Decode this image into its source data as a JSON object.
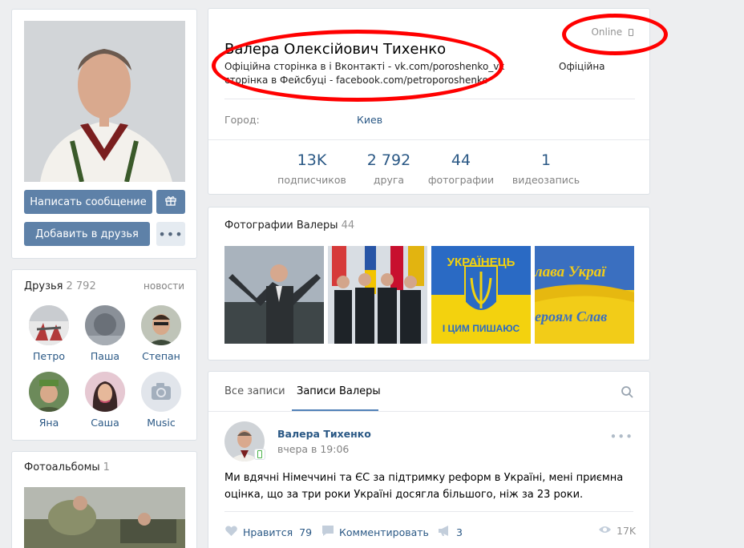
{
  "profile": {
    "name": "Валера Олексійович Тихенко",
    "line1": "Офіційна сторінка в і Вконтакті - vk.com/poroshenko_vk",
    "line2": "сторінка в Фейсбуці - facebook.com/petroporoshenko",
    "online": "Online",
    "official": "Офіційна",
    "city_label": "Город:",
    "city_value": "Киев",
    "stats": [
      {
        "value": "13K",
        "label": "подписчиков"
      },
      {
        "value": "2 792",
        "label": "друга"
      },
      {
        "value": "44",
        "label": "фотографии"
      },
      {
        "value": "1",
        "label": "видеозапись"
      }
    ]
  },
  "actions": {
    "message": "Написать сообщение",
    "add_friend": "Добавить в друзья"
  },
  "friends": {
    "title": "Друзья",
    "count": "2 792",
    "news": "новости",
    "items": [
      {
        "name": "Петро"
      },
      {
        "name": "Паша"
      },
      {
        "name": "Степан"
      },
      {
        "name": "Яна"
      },
      {
        "name": "Саша"
      },
      {
        "name": "Music"
      }
    ]
  },
  "albums": {
    "title": "Фотоальбомы",
    "count": "1"
  },
  "photos": {
    "title": "Фотографии Валеры",
    "count": "44",
    "pic3_top": "УКРАЇНЕЦЬ",
    "pic3_bottom": "І ЦИМ ПИШАЮС",
    "pic4_top": "лава Украї",
    "pic4_bottom": "ероям Слав"
  },
  "wall": {
    "tabs": [
      "Все записи",
      "Записи Валеры"
    ],
    "post": {
      "author": "Валера Тихенко",
      "time": "вчера в 19:06",
      "text": "Ми вдячні Німеччині та ЄС за підтримку реформ в Україні, мені приємна оцінка, що за три роки Україні досягла більшого, ніж за 23 роки.",
      "like_label": "Нравится",
      "likes": "79",
      "comment_label": "Комментировать",
      "shares": "3",
      "views": "17K"
    }
  },
  "colors": {
    "accent": "#5e81a8",
    "link": "#2a5885",
    "annotation": "#ff0000"
  }
}
